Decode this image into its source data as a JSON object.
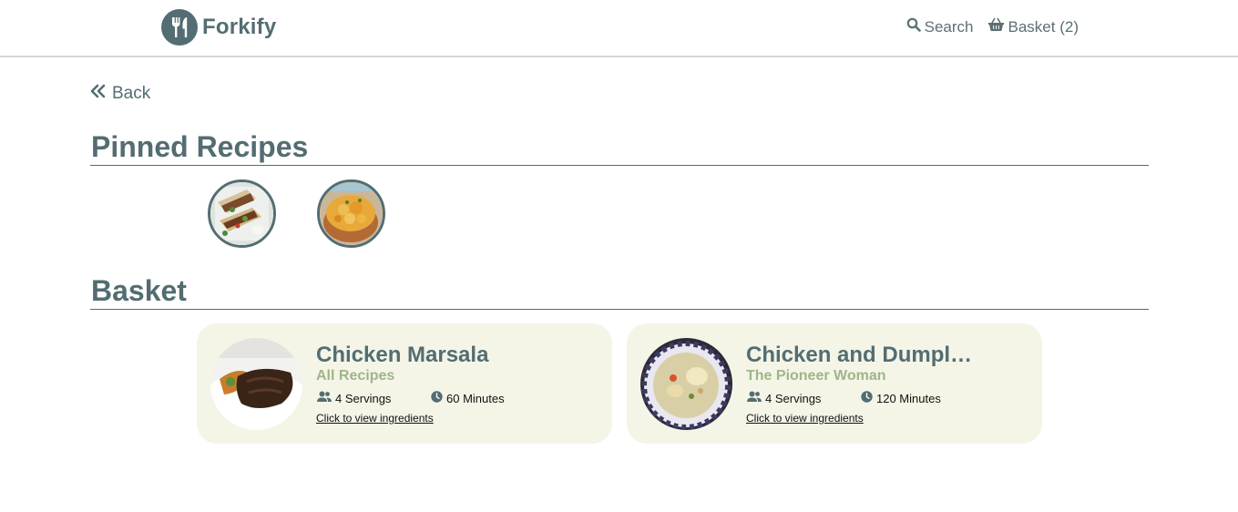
{
  "app": {
    "name": "Forkify"
  },
  "nav": {
    "search_label": "Search",
    "basket_label": "Basket (2)"
  },
  "back_label": "Back",
  "pinned": {
    "title": "Pinned Recipes",
    "items": [
      "Chicken wraps",
      "Chicken curry bread bowl"
    ]
  },
  "basket": {
    "title": "Basket",
    "cards": [
      {
        "title": "Chicken Marsala",
        "source": "All Recipes",
        "servings": "4 Servings",
        "time": "60 Minutes",
        "link": "Click to view ingredients"
      },
      {
        "title": "Chicken and Dumpl…",
        "source": "The Pioneer Woman",
        "servings": "4 Servings",
        "time": "120 Minutes",
        "link": "Click to view ingredients"
      }
    ]
  },
  "icons": [
    "fork-knife-icon",
    "search-icon",
    "basket-icon",
    "double-chevron-left-icon",
    "users-icon",
    "clock-icon"
  ],
  "colors": {
    "primary": "#536d72",
    "accent": "#9eb688",
    "card_bg": "#f4f5e7"
  }
}
